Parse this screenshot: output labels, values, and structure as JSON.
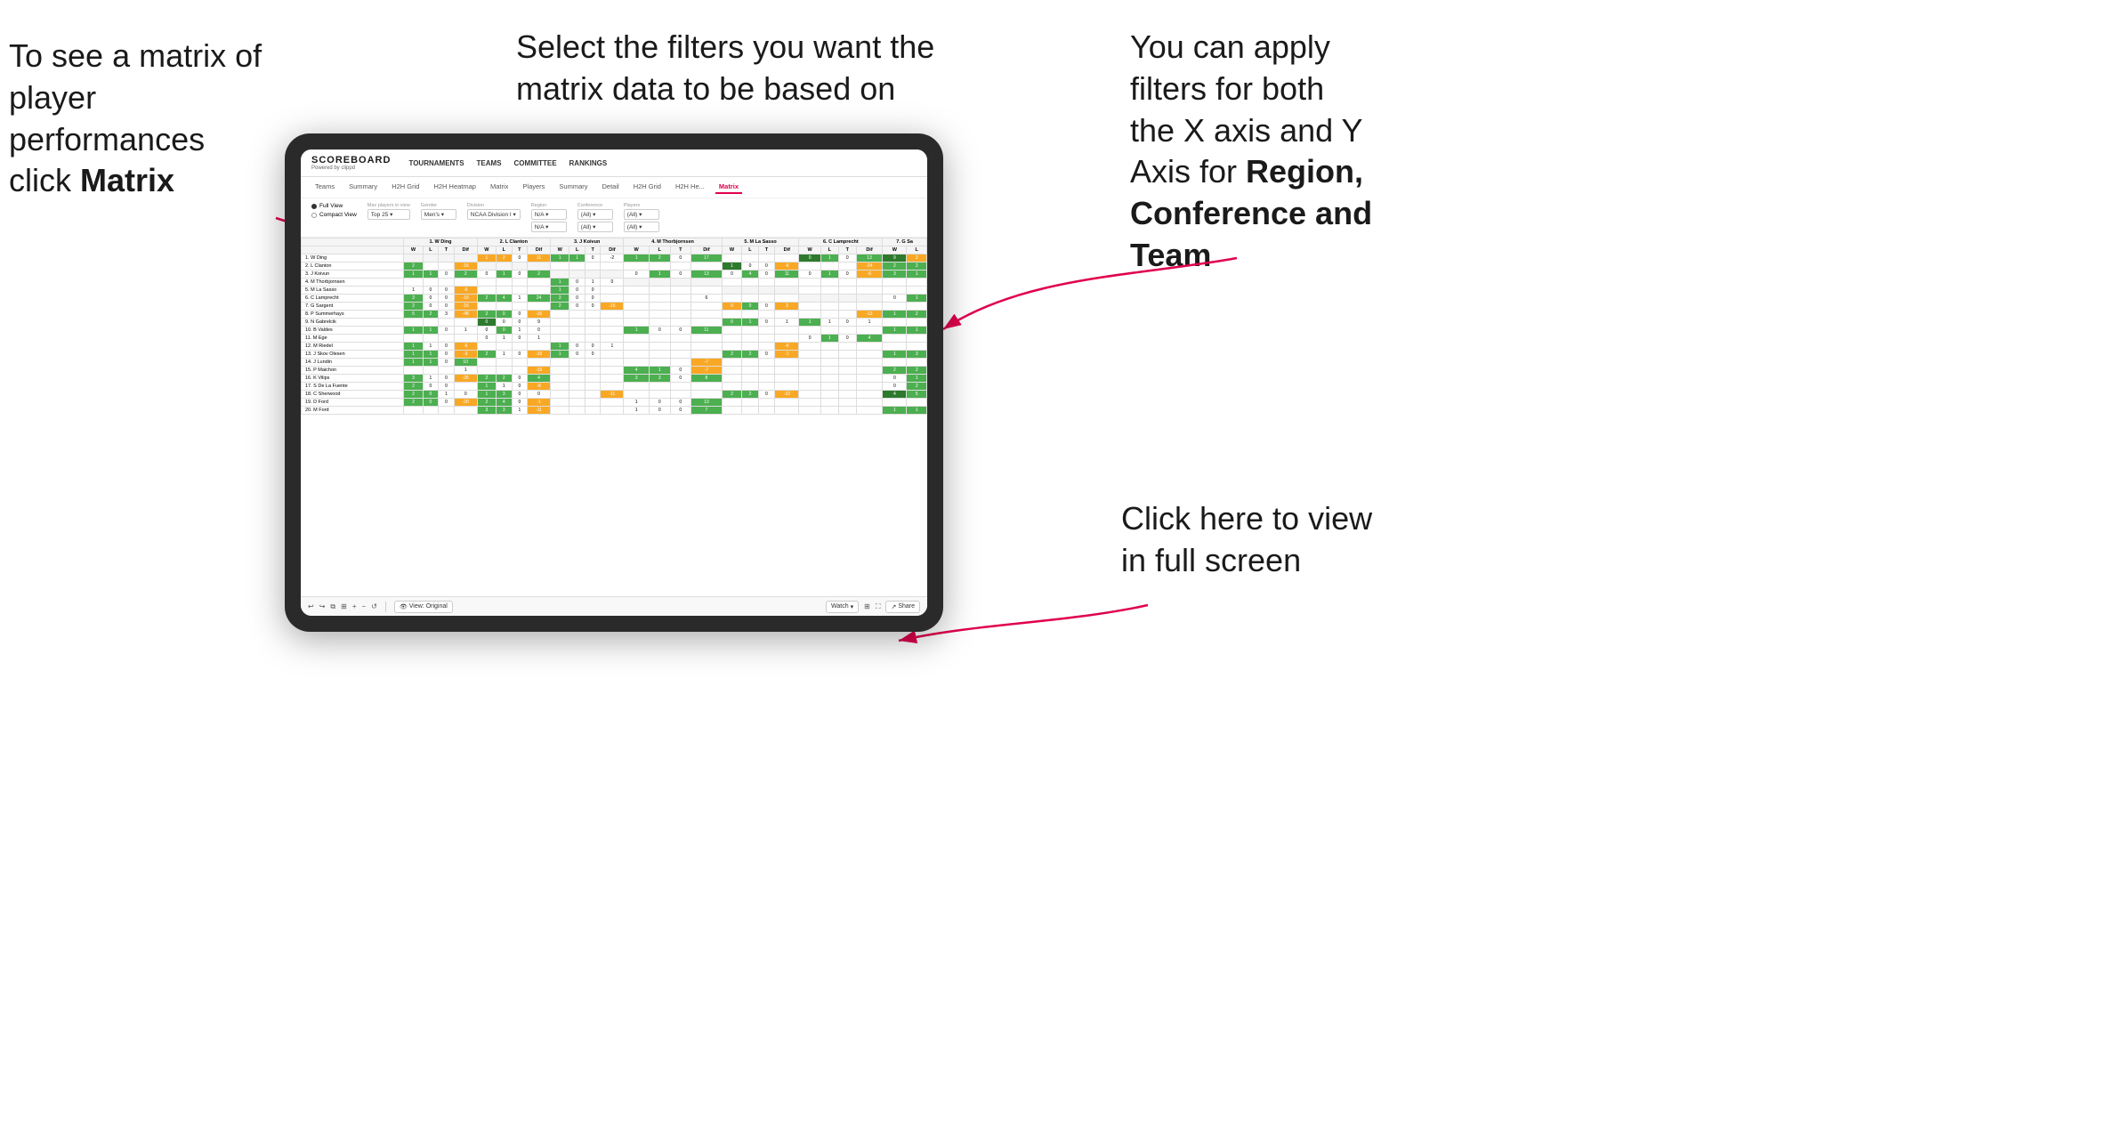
{
  "annotations": {
    "top_left": {
      "line1": "To see a matrix of",
      "line2": "player performances",
      "line3_prefix": "click ",
      "line3_bold": "Matrix"
    },
    "top_center": {
      "text": "Select the filters you want the matrix data to be based on"
    },
    "top_right": {
      "line1": "You  can apply",
      "line2": "filters for both",
      "line3": "the X axis and Y",
      "line4_prefix": "Axis for ",
      "line4_bold": "Region,",
      "line5_bold": "Conference and",
      "line6_bold": "Team"
    },
    "bottom_right": {
      "line1": "Click here to view",
      "line2": "in full screen"
    }
  },
  "app": {
    "logo": "SCOREBOARD",
    "logo_sub": "Powered by clippd",
    "nav": [
      "TOURNAMENTS",
      "TEAMS",
      "COMMITTEE",
      "RANKINGS"
    ],
    "sub_tabs": [
      "Teams",
      "Summary",
      "H2H Grid",
      "H2H Heatmap",
      "Matrix",
      "Players",
      "Summary",
      "Detail",
      "H2H Grid",
      "H2H He...",
      "Matrix"
    ],
    "active_tab": "Matrix",
    "view_options": [
      "Full View",
      "Compact View"
    ],
    "selected_view": "Full View",
    "filters": {
      "max_players": {
        "label": "Max players in view",
        "value": "Top 25"
      },
      "gender": {
        "label": "Gender",
        "value": "Men's"
      },
      "division": {
        "label": "Division",
        "value": "NCAA Division I"
      },
      "region": {
        "label": "Region",
        "value": "N/A",
        "value2": "N/A"
      },
      "conference": {
        "label": "Conference",
        "value": "(All)",
        "value2": "(All)"
      },
      "players": {
        "label": "Players",
        "value": "(All)",
        "value2": "(All)"
      }
    },
    "col_headers": [
      "1. W Ding",
      "2. L Clanton",
      "3. J Koivun",
      "4. M Thorbjornsen",
      "5. M La Sasso",
      "6. C Lamprecht",
      "7. G Sa"
    ],
    "sub_headers": [
      "W",
      "L",
      "T",
      "Dif"
    ],
    "players": [
      "1. W Ding",
      "2. L Clanton",
      "3. J Koivun",
      "4. M Thorbjornsen",
      "5. M La Sasso",
      "6. C Lamprecht",
      "7. G Sargent",
      "8. P Summerhays",
      "9. N Gabrelcik",
      "10. B Valdes",
      "11. M Ege",
      "12. M Riedel",
      "13. J Skov Olesen",
      "14. J Lundin",
      "15. P Maichon",
      "16. K Vilips",
      "17. S De La Fuente",
      "18. C Sherwood",
      "19. D Ford",
      "20. M Ford"
    ]
  },
  "toolbar": {
    "view_label": "View: Original",
    "watch_label": "Watch",
    "share_label": "Share"
  }
}
